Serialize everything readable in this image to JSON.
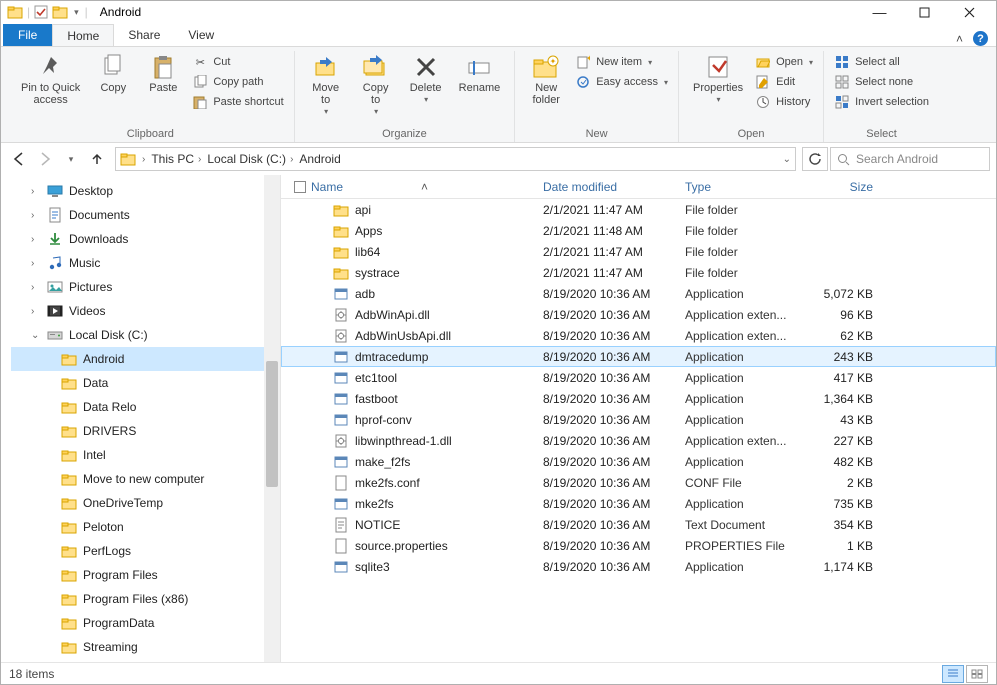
{
  "title": "Android",
  "tabs": {
    "file": "File",
    "home": "Home",
    "share": "Share",
    "view": "View"
  },
  "ribbon": {
    "clipboard": {
      "pin": "Pin to Quick\naccess",
      "copy": "Copy",
      "paste": "Paste",
      "cut": "Cut",
      "copy_path": "Copy path",
      "paste_shortcut": "Paste shortcut",
      "label": "Clipboard"
    },
    "organize": {
      "move": "Move\nto",
      "copy_to": "Copy\nto",
      "delete": "Delete",
      "rename": "Rename",
      "label": "Organize"
    },
    "new": {
      "new_folder": "New\nfolder",
      "new_item": "New item",
      "easy_access": "Easy access",
      "label": "New"
    },
    "open": {
      "properties": "Properties",
      "open": "Open",
      "edit": "Edit",
      "history": "History",
      "label": "Open"
    },
    "select": {
      "all": "Select all",
      "none": "Select none",
      "invert": "Invert selection",
      "label": "Select"
    }
  },
  "breadcrumbs": [
    "This PC",
    "Local Disk (C:)",
    "Android"
  ],
  "search_placeholder": "Search Android",
  "tree": [
    {
      "label": "Desktop",
      "indent": 1,
      "icon": "desktop"
    },
    {
      "label": "Documents",
      "indent": 1,
      "icon": "docs"
    },
    {
      "label": "Downloads",
      "indent": 1,
      "icon": "downloads"
    },
    {
      "label": "Music",
      "indent": 1,
      "icon": "music"
    },
    {
      "label": "Pictures",
      "indent": 1,
      "icon": "pictures"
    },
    {
      "label": "Videos",
      "indent": 1,
      "icon": "videos"
    },
    {
      "label": "Local Disk (C:)",
      "indent": 1,
      "icon": "disk",
      "expanded": true
    },
    {
      "label": "Android",
      "indent": 2,
      "icon": "folder",
      "selected": true
    },
    {
      "label": "Data",
      "indent": 2,
      "icon": "folder"
    },
    {
      "label": "Data Relo",
      "indent": 2,
      "icon": "folder"
    },
    {
      "label": "DRIVERS",
      "indent": 2,
      "icon": "folder"
    },
    {
      "label": "Intel",
      "indent": 2,
      "icon": "folder"
    },
    {
      "label": "Move to new computer",
      "indent": 2,
      "icon": "folder"
    },
    {
      "label": "OneDriveTemp",
      "indent": 2,
      "icon": "folder"
    },
    {
      "label": "Peloton",
      "indent": 2,
      "icon": "folder"
    },
    {
      "label": "PerfLogs",
      "indent": 2,
      "icon": "folder"
    },
    {
      "label": "Program Files",
      "indent": 2,
      "icon": "folder"
    },
    {
      "label": "Program Files (x86)",
      "indent": 2,
      "icon": "folder"
    },
    {
      "label": "ProgramData",
      "indent": 2,
      "icon": "folder"
    },
    {
      "label": "Streaming",
      "indent": 2,
      "icon": "folder"
    }
  ],
  "columns": {
    "name": "Name",
    "date": "Date modified",
    "type": "Type",
    "size": "Size"
  },
  "files": [
    {
      "name": "api",
      "date": "2/1/2021 11:47 AM",
      "type": "File folder",
      "size": "",
      "icon": "folder"
    },
    {
      "name": "Apps",
      "date": "2/1/2021 11:48 AM",
      "type": "File folder",
      "size": "",
      "icon": "folder"
    },
    {
      "name": "lib64",
      "date": "2/1/2021 11:47 AM",
      "type": "File folder",
      "size": "",
      "icon": "folder"
    },
    {
      "name": "systrace",
      "date": "2/1/2021 11:47 AM",
      "type": "File folder",
      "size": "",
      "icon": "folder"
    },
    {
      "name": "adb",
      "date": "8/19/2020 10:36 AM",
      "type": "Application",
      "size": "5,072 KB",
      "icon": "exe"
    },
    {
      "name": "AdbWinApi.dll",
      "date": "8/19/2020 10:36 AM",
      "type": "Application exten...",
      "size": "96 KB",
      "icon": "dll"
    },
    {
      "name": "AdbWinUsbApi.dll",
      "date": "8/19/2020 10:36 AM",
      "type": "Application exten...",
      "size": "62 KB",
      "icon": "dll"
    },
    {
      "name": "dmtracedump",
      "date": "8/19/2020 10:36 AM",
      "type": "Application",
      "size": "243 KB",
      "icon": "exe",
      "hovered": true
    },
    {
      "name": "etc1tool",
      "date": "8/19/2020 10:36 AM",
      "type": "Application",
      "size": "417 KB",
      "icon": "exe"
    },
    {
      "name": "fastboot",
      "date": "8/19/2020 10:36 AM",
      "type": "Application",
      "size": "1,364 KB",
      "icon": "exe"
    },
    {
      "name": "hprof-conv",
      "date": "8/19/2020 10:36 AM",
      "type": "Application",
      "size": "43 KB",
      "icon": "exe"
    },
    {
      "name": "libwinpthread-1.dll",
      "date": "8/19/2020 10:36 AM",
      "type": "Application exten...",
      "size": "227 KB",
      "icon": "dll"
    },
    {
      "name": "make_f2fs",
      "date": "8/19/2020 10:36 AM",
      "type": "Application",
      "size": "482 KB",
      "icon": "exe"
    },
    {
      "name": "mke2fs.conf",
      "date": "8/19/2020 10:36 AM",
      "type": "CONF File",
      "size": "2 KB",
      "icon": "file"
    },
    {
      "name": "mke2fs",
      "date": "8/19/2020 10:36 AM",
      "type": "Application",
      "size": "735 KB",
      "icon": "exe"
    },
    {
      "name": "NOTICE",
      "date": "8/19/2020 10:36 AM",
      "type": "Text Document",
      "size": "354 KB",
      "icon": "txt"
    },
    {
      "name": "source.properties",
      "date": "8/19/2020 10:36 AM",
      "type": "PROPERTIES File",
      "size": "1 KB",
      "icon": "file"
    },
    {
      "name": "sqlite3",
      "date": "8/19/2020 10:36 AM",
      "type": "Application",
      "size": "1,174 KB",
      "icon": "exe"
    }
  ],
  "status": "18 items"
}
